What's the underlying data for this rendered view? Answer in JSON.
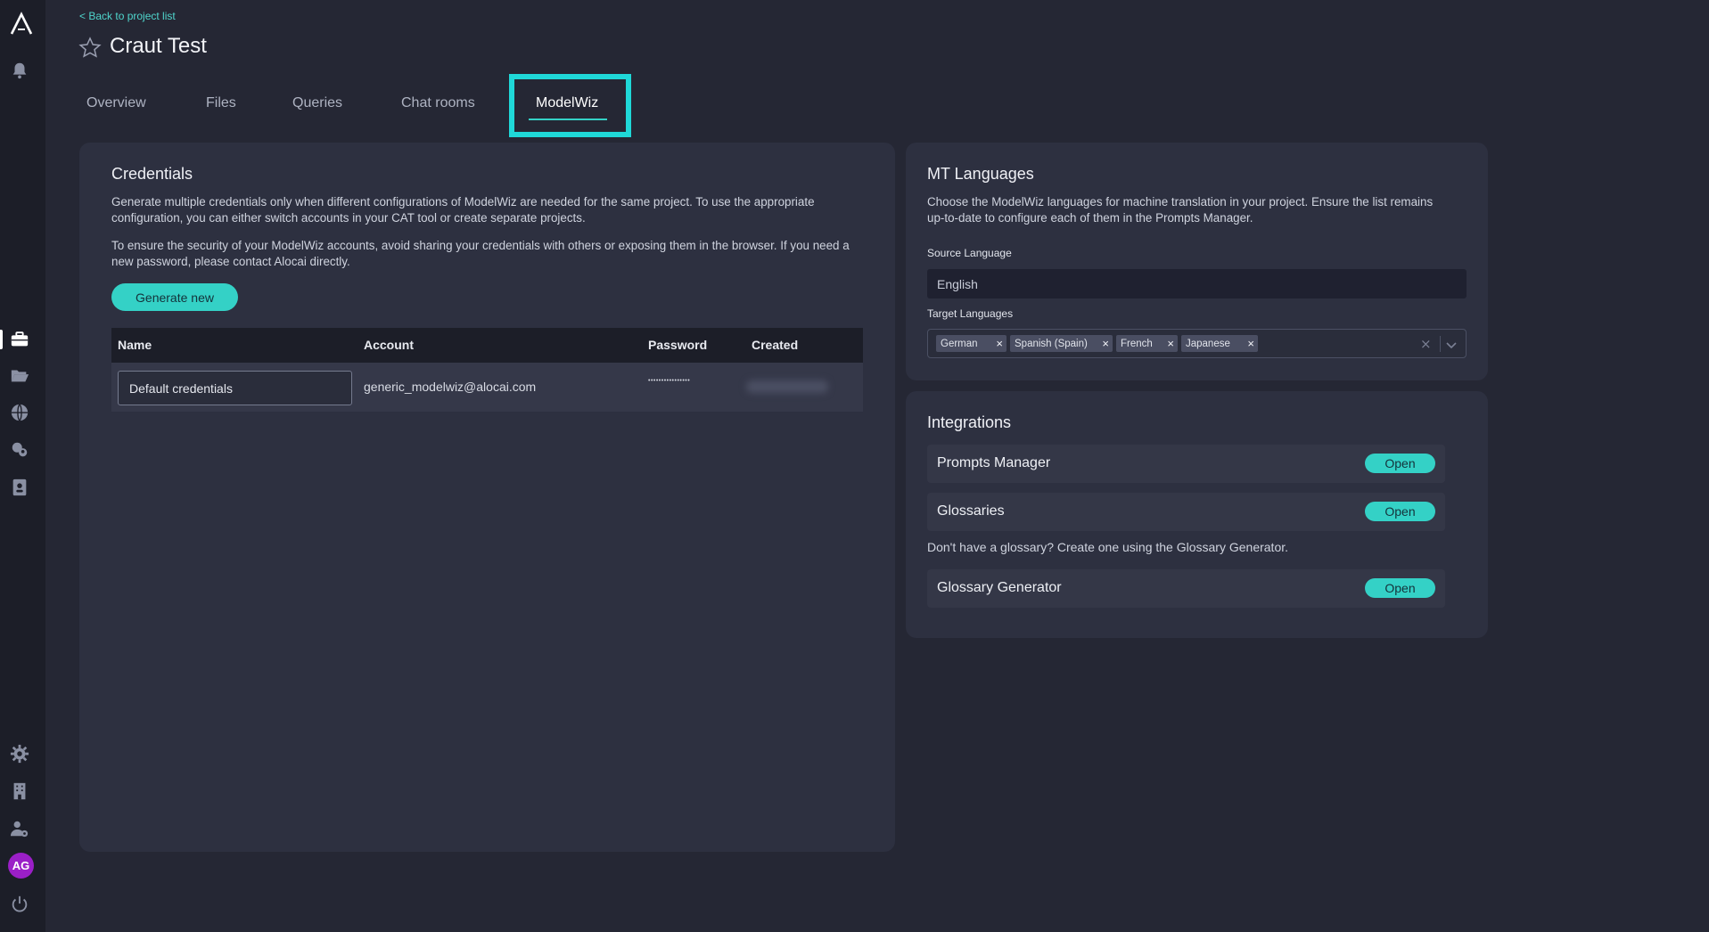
{
  "sidebar": {
    "logo_icon": "app-logo-icon",
    "icons": [
      "bell-icon",
      "briefcase-icon",
      "folder-open-icon",
      "globe-icon",
      "chat-users-icon",
      "address-book-icon",
      "gear-icon",
      "building-icon",
      "user-cog-icon",
      "power-icon"
    ],
    "avatar_initials": "AG"
  },
  "header": {
    "back_link": "< Back to project list",
    "project_title": "Craut Test"
  },
  "tabs": [
    {
      "label": "Overview"
    },
    {
      "label": "Files"
    },
    {
      "label": "Queries"
    },
    {
      "label": "Chat rooms"
    },
    {
      "label": "ModelWiz",
      "active": true
    }
  ],
  "credentials": {
    "title": "Credentials",
    "para1": "Generate multiple credentials only when different configurations of ModelWiz are needed for the same project. To use the appropriate configuration, you can either switch accounts in your CAT tool or create separate projects.",
    "para2": "To ensure the security of your ModelWiz accounts, avoid sharing your credentials with others or exposing them in the browser. If you need a new password, please contact Alocai directly.",
    "generate_button": "Generate new",
    "columns": [
      "Name",
      "Account",
      "Password",
      "Created"
    ],
    "row": {
      "name": "Default credentials",
      "account": "generic_modelwiz@alocai.com",
      "password": "••••••••••••••••"
    }
  },
  "mt_languages": {
    "title": "MT Languages",
    "description": "Choose the ModelWiz languages for machine translation in your project. Ensure the list remains up-to-date to configure each of them in the Prompts Manager.",
    "source_label": "Source Language",
    "source_value": "English",
    "target_label": "Target Languages",
    "targets": [
      "German",
      "Spanish (Spain)",
      "French",
      "Japanese"
    ],
    "chip_remove": "×",
    "clear_glyph": "×"
  },
  "integrations": {
    "title": "Integrations",
    "prompts_manager": "Prompts Manager",
    "glossaries": "Glossaries",
    "glossary_hint": "Don't have a glossary? Create one using the Glossary Generator.",
    "glossary_generator": "Glossary Generator",
    "open_label": "Open"
  },
  "colors": {
    "accent": "#34d1c6",
    "highlight_box": "#1fd8d8",
    "background": "#252734",
    "panel": "#2d3040",
    "avatar": "#9b1fc7"
  }
}
